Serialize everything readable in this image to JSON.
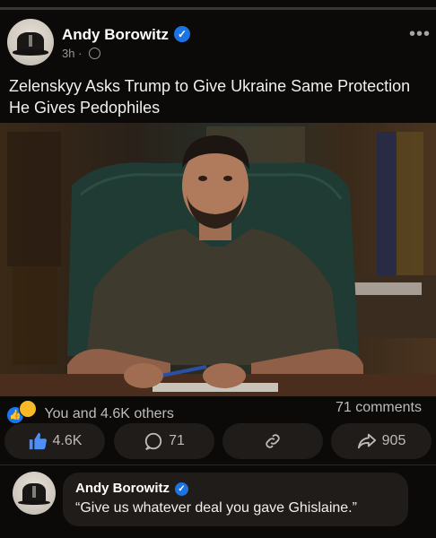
{
  "post": {
    "author": "Andy Borowitz",
    "time": "3h",
    "separator": "·",
    "more_label": "•••",
    "text": "Zelenskyy Asks Trump to Give Ukraine Same Protection He Gives Pedophiles",
    "photo_alt": "Man in dark t-shirt seated in green leather chair at a desk holding a pen"
  },
  "engagement": {
    "reactions_text": "You and 4.6K others",
    "comments_text": "71 comments",
    "like_count": "4.6K",
    "comment_count": "71",
    "share_count": "905"
  },
  "comment": {
    "author": "Andy Borowitz",
    "text": "“Give us whatever deal you gave Ghislaine.”"
  },
  "colors": {
    "background": "#0c0a09",
    "button_bg": "#1f1c1a",
    "verified_blue": "#1b74e4",
    "like_blue": "#1877f2"
  },
  "icons": [
    "verified-icon",
    "globe-icon",
    "more-icon",
    "like-icon",
    "haha-icon",
    "thumbs-up-icon",
    "comment-icon",
    "link-icon",
    "share-icon"
  ]
}
